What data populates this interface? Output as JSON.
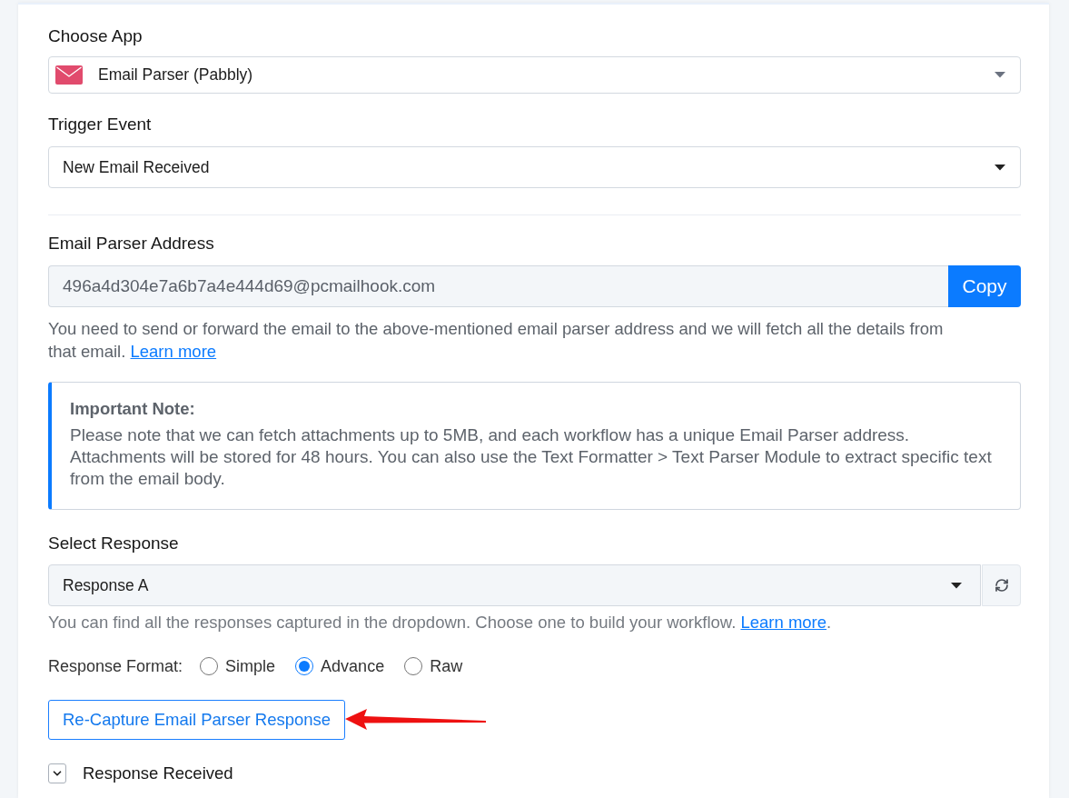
{
  "app_field": {
    "label": "Choose App",
    "value": "Email Parser (Pabbly)"
  },
  "trigger_field": {
    "label": "Trigger Event",
    "value": "New Email Received"
  },
  "address_field": {
    "label": "Email Parser Address",
    "value": "496a4d304e7a6b7a4e444d69@pcmailhook.com",
    "button": "Copy",
    "help": "You need to send or forward the email to the above-mentioned email parser address and we will fetch all the details from that email.",
    "help_link": "Learn more"
  },
  "note": {
    "title": "Important Note:",
    "text": "Please note that we can fetch attachments up to 5MB, and each workflow has a unique Email Parser address. Attachments will be stored for 48 hours. You can also use the Text Formatter > Text Parser Module to extract specific text from the email body."
  },
  "response_field": {
    "label": "Select Response",
    "value": "Response A",
    "help": "You can find all the responses captured in the dropdown. Choose one to build your workflow.",
    "help_link": "Learn more",
    "help_tail": "."
  },
  "response_format": {
    "label": "Response Format:",
    "options": [
      {
        "label": "Simple",
        "selected": false
      },
      {
        "label": "Advance",
        "selected": true
      },
      {
        "label": "Raw",
        "selected": false
      }
    ]
  },
  "recapture_button": "Re-Capture Email Parser Response",
  "response_received": {
    "label": "Response Received"
  }
}
